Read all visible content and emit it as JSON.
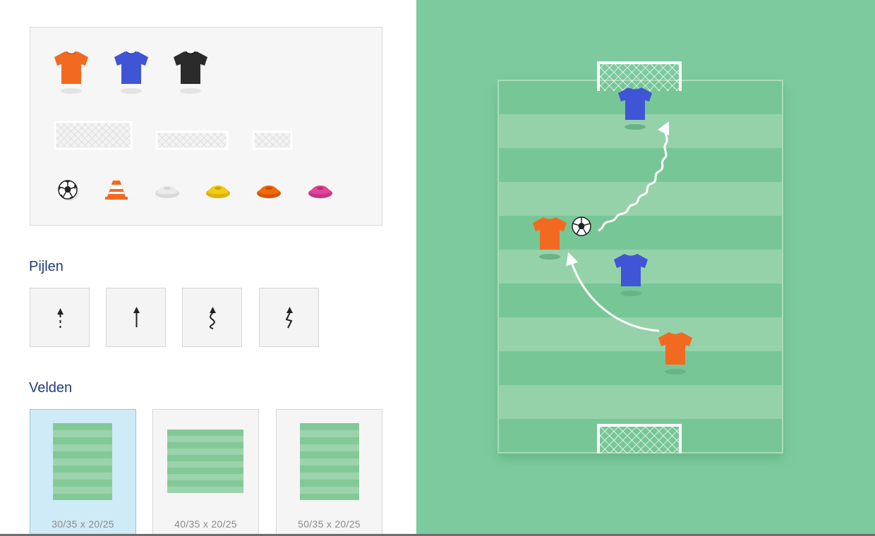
{
  "palette": {
    "shirts": [
      {
        "name": "orange-shirt",
        "color": "#f26a21"
      },
      {
        "name": "blue-shirt",
        "color": "#3f55d6"
      },
      {
        "name": "black-shirt",
        "color": "#2b2b2b"
      }
    ],
    "goals": [
      "large-goal",
      "medium-goal",
      "small-goal"
    ],
    "equipment": [
      {
        "name": "ball-icon",
        "color": "#222222"
      },
      {
        "name": "cone-icon",
        "color": "#f26a21"
      },
      {
        "name": "white-disc-cone-icon",
        "color": "#e6e6e6"
      },
      {
        "name": "yellow-disc-cone-icon",
        "color": "#f2cc14"
      },
      {
        "name": "orange-disc-cone-icon",
        "color": "#f26a06"
      },
      {
        "name": "pink-disc-cone-icon",
        "color": "#e2459a"
      }
    ]
  },
  "arrows": {
    "title": "Pijlen",
    "items": [
      "dashed-arrow-icon",
      "straight-arrow-icon",
      "wavy-arrow-icon",
      "zigzag-arrow-icon"
    ]
  },
  "fields": {
    "title": "Velden",
    "items": [
      {
        "label": "30/35 x 20/25",
        "selected": true
      },
      {
        "label": "40/35 x 20/25",
        "selected": false
      },
      {
        "label": "50/35 x 20/25",
        "selected": false
      }
    ]
  },
  "colors": {
    "background_green": "#7dca9e",
    "stripe_dark": "#77c796",
    "stripe_light": "#95d2aa",
    "heading": "#213c7a",
    "selected_card": "#cfebf7"
  },
  "board": {
    "players": [
      {
        "name": "blue-player-goal",
        "team": "blue"
      },
      {
        "name": "orange-player-ball",
        "team": "orange"
      },
      {
        "name": "blue-player-defender",
        "team": "blue"
      },
      {
        "name": "orange-player-runner",
        "team": "orange"
      }
    ],
    "arrows": [
      "wavy-dribble-arrow",
      "curved-run-arrow"
    ]
  }
}
